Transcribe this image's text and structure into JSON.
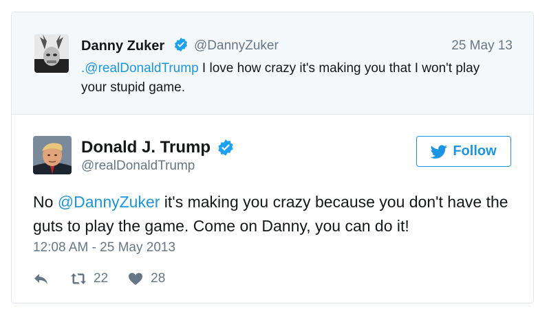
{
  "quoted": {
    "name": "Danny Zuker",
    "handle": "@DannyZuker",
    "date": "25 May 13",
    "mention": ".@realDonaldTrump",
    "text": " I love how crazy it's making you that I won't play your stupid game."
  },
  "tweet": {
    "name": "Donald J. Trump",
    "handle": "@realDonaldTrump",
    "follow_label": "Follow",
    "text_before": "No ",
    "mention": "@DannyZuker",
    "text_after": " it's making you crazy because you don't have the guts to play the game. Come on Danny, you can do it!",
    "timestamp": "12:08 AM - 25 May 2013",
    "retweets": "22",
    "likes": "28"
  },
  "colors": {
    "accent": "#1b95e0",
    "muted": "#657786",
    "parent_bg": "#f5f8fa",
    "verified": "#1da1f2"
  },
  "icons": {
    "verified": "verified-badge-icon",
    "bird": "twitter-bird-icon",
    "reply": "reply-icon",
    "retweet": "retweet-icon",
    "like": "heart-icon"
  }
}
